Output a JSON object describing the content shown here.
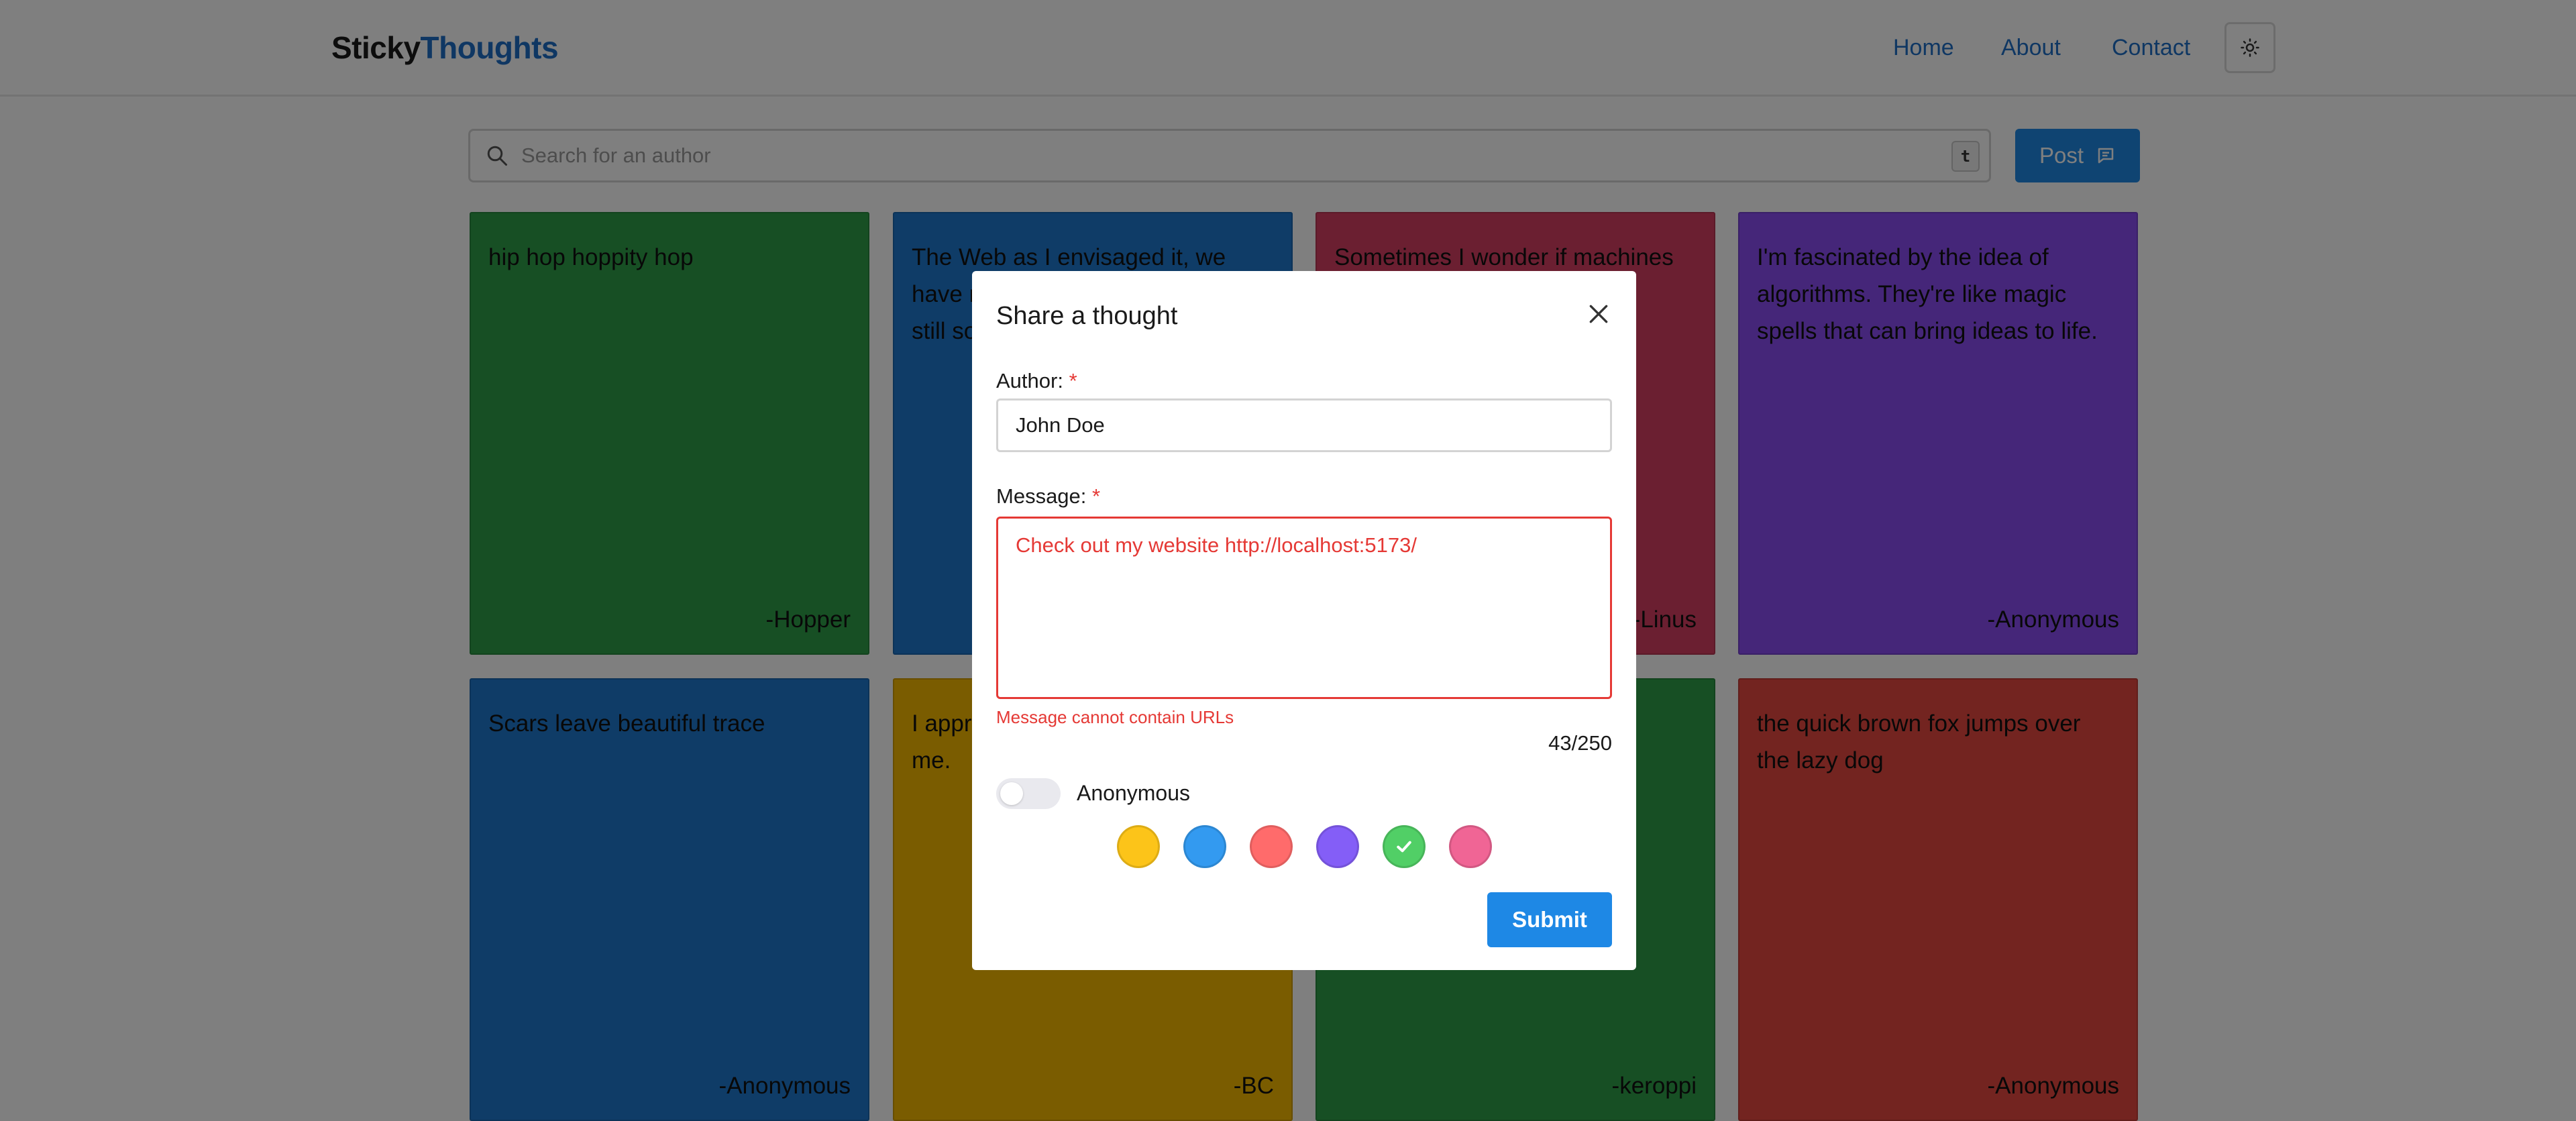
{
  "header": {
    "logo_part1": "Sticky",
    "logo_part2": "Thoughts",
    "nav": [
      {
        "label": "Home"
      },
      {
        "label": "About"
      },
      {
        "label": "Contact"
      }
    ],
    "theme_toggle_icon": "sun-icon"
  },
  "search": {
    "placeholder": "Search for an author",
    "value": "",
    "shortcut_key": "t",
    "post_label": "Post",
    "post_icon": "message-icon"
  },
  "cards": [
    {
      "text": "hip hop hoppity hop",
      "author": "-Hopper",
      "color": "#2e9e48"
    },
    {
      "text": "The Web as I envisaged it, we have not seen it yet. The future is still so much bigger than the past.",
      "author": "",
      "color": "#1e78cf"
    },
    {
      "text": "Sometimes I wonder if machines can really think like humans.",
      "author": "-Linus",
      "color": "#d63f62"
    },
    {
      "text": "I'm fascinated by the idea of algorithms. They're like magic spells that can bring ideas to life.",
      "author": "-Anonymous",
      "color": "#8a4cf2"
    },
    {
      "text": "Scars leave beautiful trace",
      "author": "-Anonymous",
      "color": "#1e78cf"
    },
    {
      "text": "I appreciate everything you do for me.",
      "author": "-BC",
      "color": "#f5b800"
    },
    {
      "text": "",
      "author": "-keroppi",
      "color": "#2e9e48"
    },
    {
      "text": "the quick brown fox jumps over the lazy dog",
      "author": "-Anonymous",
      "color": "#e64840"
    }
  ],
  "modal": {
    "title": "Share a thought",
    "author_label": "Author:",
    "author_value": "John Doe",
    "required_mark": "*",
    "message_label": "Message:",
    "message_value": "Check out my website http://localhost:5173/",
    "error": "Message cannot contain URLs",
    "counter": "43/250",
    "anonymous_label": "Anonymous",
    "anonymous_on": false,
    "colors": [
      {
        "name": "yellow",
        "hex": "#fcc419",
        "selected": false
      },
      {
        "name": "blue",
        "hex": "#339af0",
        "selected": false
      },
      {
        "name": "red",
        "hex": "#ff6b6b",
        "selected": false
      },
      {
        "name": "violet",
        "hex": "#845ef7",
        "selected": false
      },
      {
        "name": "green",
        "hex": "#51cf66",
        "selected": true
      },
      {
        "name": "pink",
        "hex": "#f06595",
        "selected": false
      }
    ],
    "submit_label": "Submit"
  }
}
